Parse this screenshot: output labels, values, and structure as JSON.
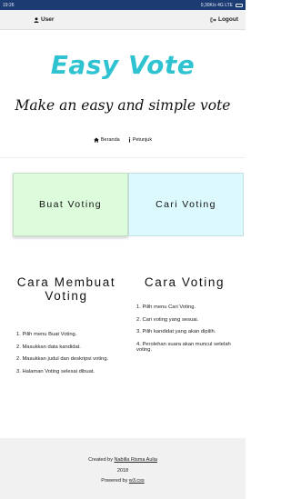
{
  "status_bar": {
    "time": "19:26",
    "right": "0,30K/s  4G  LTE"
  },
  "top_bar": {
    "user_label": "User",
    "logout_label": "Logout"
  },
  "logo": "Easy Vote",
  "tagline": "Make an easy and simple vote",
  "nav": {
    "home_label": "Beranda",
    "help_label": "Petunjuk"
  },
  "cards": {
    "buat_label": "Buat Voting",
    "cari_label": "Cari Voting"
  },
  "left_section": {
    "title": "Cara Membuat Voting",
    "steps": [
      "1. Pilih menu Buat Voting.",
      "2. Masukkan data kandidat.",
      "2. Masukkan judul dan deskripsi voting.",
      "3. Halaman Voting selesai dibuat."
    ]
  },
  "right_section": {
    "title": "Cara Voting",
    "steps": [
      "1. Pilih menu Cari Voting.",
      "2. Cari voting yang sesuai.",
      "3. Pilih kandidat yang akan dipilih.",
      "4. Perolehan suara akan muncul setelah voting."
    ]
  },
  "footer": {
    "created_prefix": "Created by ",
    "author": "Nabilla Risma Aulia",
    "year": "2018",
    "powered_prefix": "Powered by ",
    "powered_link": "w3.css"
  },
  "icons": [
    "person-icon",
    "logout-icon",
    "home-icon",
    "info-icon"
  ]
}
